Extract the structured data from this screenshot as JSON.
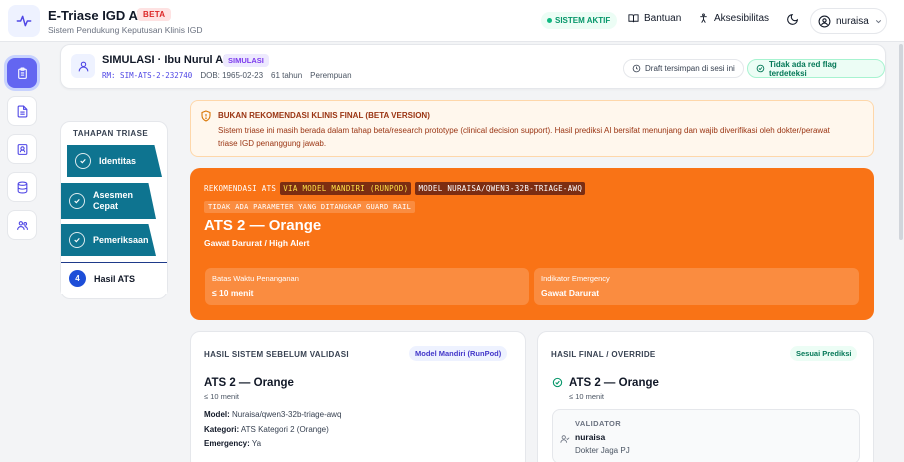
{
  "header": {
    "app_title": "E-Triase IGD ATS",
    "beta": "BETA",
    "subtitle": "Sistem Pendukung Keputusan Klinis IGD",
    "system_status": "SISTEM AKTIF",
    "help": "Bantuan",
    "accessibility": "Aksesibilitas",
    "user": "nuraisa"
  },
  "patient": {
    "name": "SIMULASI · Ibu Nurul Aini",
    "badge": "SIMULASI",
    "rm": "RM: SIM-ATS-2-232740",
    "dob": "DOB: 1965-02-23",
    "age": "61 tahun",
    "sex": "Perempuan",
    "draft": "Draft tersimpan di sesi ini",
    "red_flag": "Tidak ada red flag terdeteksi"
  },
  "stepper": {
    "title": "TAHAPAN TRIASE",
    "steps": [
      {
        "label": "Identitas"
      },
      {
        "label": "Asesmen Cepat"
      },
      {
        "label": "Pemeriksaan"
      },
      {
        "num": "4",
        "label": "Hasil ATS"
      }
    ]
  },
  "warning": {
    "title": "BUKAN REKOMENDASI KLINIS FINAL (BETA VERSION)",
    "body": "Sistem triase ini masih berada dalam tahap beta/research prototype (clinical decision support). Hasil prediksi AI bersifat menunjang dan wajib diverifikasi oleh dokter/perawat triase IGD penanggung jawab."
  },
  "recommendation": {
    "prefix": "REKOMENDASI ATS",
    "via": "VIA MODEL MANDIRI (RUNPOD)",
    "model": "MODEL NURAISA/QWEN3-32B-TRIAGE-AWQ",
    "guardrail": "TIDAK ADA PARAMETER YANG DITANGKAP GUARD RAIL",
    "ats": "ATS 2 — Orange",
    "desc": "Gawat Darurat / High Alert",
    "time_label": "Batas Waktu Penanganan",
    "time_value": "≤ 10 menit",
    "emergency_label": "Indikator Emergency",
    "emergency_value": "Gawat Darurat"
  },
  "system_result": {
    "title": "HASIL SISTEM SEBELUM VALIDASI",
    "badge": "Model Mandiri (RunPod)",
    "ats": "ATS 2 — Orange",
    "time": "≤ 10 menit",
    "model_label": "Model:",
    "model_value": "Nuraisa/qwen3-32b-triage-awq",
    "category_label": "Kategori:",
    "category_value": "ATS Kategori 2 (Orange)",
    "emergency_label": "Emergency:",
    "emergency_value": "Ya"
  },
  "final_result": {
    "title": "HASIL FINAL / OVERRIDE",
    "badge": "Sesuai Prediksi",
    "ats": "ATS 2 — Orange",
    "time": "≤ 10 menit",
    "validator_label": "VALIDATOR",
    "validator_name": "nuraisa",
    "validator_role": "Dokter Jaga PJ"
  },
  "colors": {
    "accent": "#6366f1",
    "ats_orange": "#f97316",
    "success": "#059669",
    "step": "#0e7490"
  }
}
